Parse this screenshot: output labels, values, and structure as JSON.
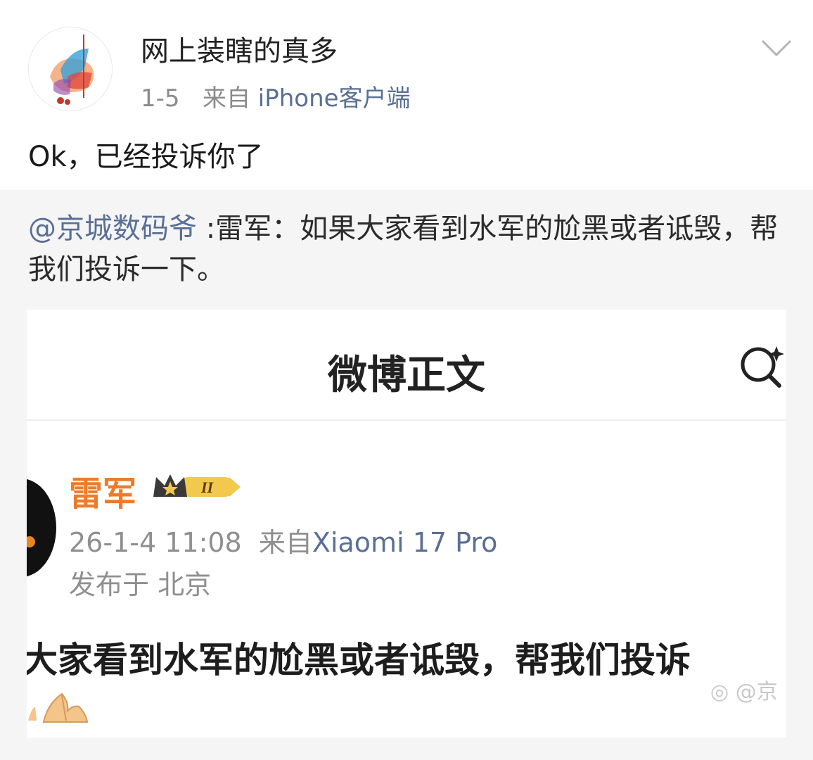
{
  "post": {
    "username": "网上装瞎的真多",
    "date": "1-5",
    "from_label": "来自",
    "source": "iPhone客户端",
    "text": "Ok，已经投诉你了"
  },
  "repost": {
    "mention": "@京城数码爷",
    "text": " :雷军：如果大家看到水军的尬黑或者诋毁，帮我们投诉一下。"
  },
  "screenshot": {
    "title": "微博正文",
    "name": "雷军",
    "badge_text": "II",
    "datetime": "26-1-4 11:08",
    "from_label": "来自",
    "source": "Xiaomi 17 Pro",
    "location": "发布于 北京",
    "body": "大家看到水军的尬黑或者诋毁，帮我们投诉",
    "watermark": "@京"
  },
  "icons": {
    "menu": "chevron-down-icon",
    "search": "search-sparkle-icon",
    "emoji": "praying-hands-icon"
  },
  "colors": {
    "link": "#5a6f94",
    "name_orange": "#ec7c2a",
    "repost_bg": "#f5f5f5"
  }
}
